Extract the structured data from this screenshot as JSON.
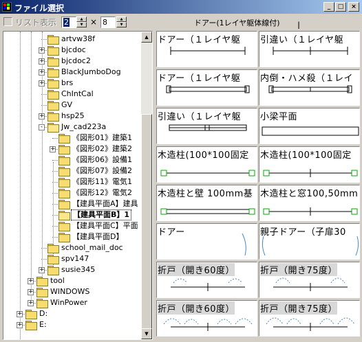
{
  "window": {
    "title": "ファイル選択",
    "buttons": {
      "minimize": "_",
      "maximize": "□",
      "close": "×"
    }
  },
  "toolbar": {
    "list_view_label": "リスト表示",
    "list_view_checked": false,
    "cols_value": "2",
    "rows_value": "8",
    "times_symbol": "×",
    "preview_title": "ドアー(1レイヤ躯体線付)"
  },
  "tree": {
    "nodes": [
      {
        "label": "artvw38f",
        "expander": ""
      },
      {
        "label": "bjcdoc",
        "expander": "+"
      },
      {
        "label": "bjcdoc2",
        "expander": "+"
      },
      {
        "label": "BlackJumboDog",
        "expander": "+"
      },
      {
        "label": "brs",
        "expander": "+"
      },
      {
        "label": "ChIntCal",
        "expander": ""
      },
      {
        "label": "GV",
        "expander": ""
      },
      {
        "label": "hsp25",
        "expander": "+"
      },
      {
        "label": "Jw_cad223a",
        "expander": "-"
      },
      {
        "label": "《図形01》建築1",
        "expander": ""
      },
      {
        "label": "《図形02》建築2",
        "expander": "+"
      },
      {
        "label": "《図形06》設備1",
        "expander": ""
      },
      {
        "label": "《図形07》設備2",
        "expander": ""
      },
      {
        "label": "《図形11》電気1",
        "expander": ""
      },
      {
        "label": "《図形12》電気2",
        "expander": ""
      },
      {
        "label": "【建具平面A】建具",
        "expander": ""
      },
      {
        "label": "【建具平面B】1",
        "expander": "",
        "selected": true
      },
      {
        "label": "【建具平面C】平面",
        "expander": ""
      },
      {
        "label": "【建具平面D】",
        "expander": ""
      },
      {
        "label": "school_mail_doc",
        "expander": ""
      },
      {
        "label": "spv147",
        "expander": ""
      },
      {
        "label": "susie345",
        "expander": "+"
      },
      {
        "label": "tool",
        "expander": "+"
      },
      {
        "label": "WINDOWS",
        "expander": "+"
      },
      {
        "label": "WinPower",
        "expander": "+"
      },
      {
        "label": "D:",
        "expander": "+"
      },
      {
        "label": "E:",
        "expander": "+"
      }
    ]
  },
  "thumbnails": [
    {
      "caption": "ドアー（１レイヤ躯",
      "kind": "door-line"
    },
    {
      "caption": "引違い（１レイヤ躯",
      "kind": "sliding-line"
    },
    {
      "caption": "ドアー（１レイヤ躯",
      "kind": "door-frame"
    },
    {
      "caption": "内倒・ハメ殺（１レイ",
      "kind": "inward-frame"
    },
    {
      "caption": "引違い（１レイヤ躯",
      "kind": "sliding-frame"
    },
    {
      "caption": "小梁平面",
      "kind": "beam"
    },
    {
      "caption": "木造柱(100*100固定",
      "kind": "wood-column"
    },
    {
      "caption": "木造柱(100*100固定",
      "kind": "wood-column-mid"
    },
    {
      "caption": "木造柱と壁 100mm基",
      "kind": "wood-wall"
    },
    {
      "caption": "木造柱と窓100,50mm",
      "kind": "wood-window"
    },
    {
      "caption": "ドアー",
      "kind": "door-swing"
    },
    {
      "caption": "親子ドアー（子扉30",
      "kind": "double-door"
    },
    {
      "caption": "折戸（開き60度）",
      "kind": "fold-60-a"
    },
    {
      "caption": "折戸（開き75度）",
      "kind": "fold-75-a"
    },
    {
      "caption": "折戸（開き60度）",
      "kind": "fold-60-b"
    },
    {
      "caption": "折戸（開き75度）",
      "kind": "fold-75-b"
    }
  ]
}
